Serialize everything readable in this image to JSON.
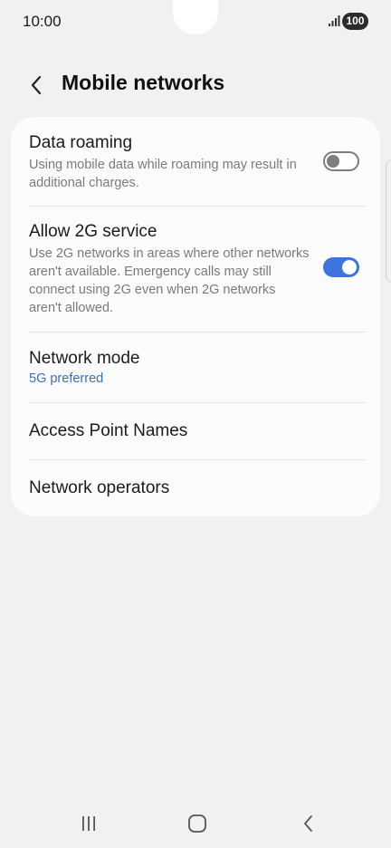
{
  "status_bar": {
    "time": "10:00",
    "battery": "100",
    "signal_icon": "signal-bars-icon"
  },
  "header": {
    "back_icon": "chevron-left-icon",
    "title": "Mobile networks"
  },
  "settings": {
    "data_roaming": {
      "title": "Data roaming",
      "description": "Using mobile data while roaming may result in additional charges.",
      "toggle_state": "off"
    },
    "allow_2g": {
      "title": "Allow 2G service",
      "description": "Use 2G networks in areas where other networks aren't available. Emergency calls may still connect using 2G even when 2G networks aren't allowed.",
      "toggle_state": "on"
    },
    "network_mode": {
      "title": "Network mode",
      "value": "5G preferred"
    },
    "access_point_names": {
      "title": "Access Point Names"
    },
    "network_operators": {
      "title": "Network operators"
    }
  },
  "navbar": {
    "recents_icon": "recents-icon",
    "home_icon": "home-icon",
    "back_icon": "back-icon"
  },
  "colors": {
    "accent": "#3e73e0",
    "link": "#3a6fb8",
    "background": "#f1f1f3",
    "card": "#fcfcfd"
  }
}
